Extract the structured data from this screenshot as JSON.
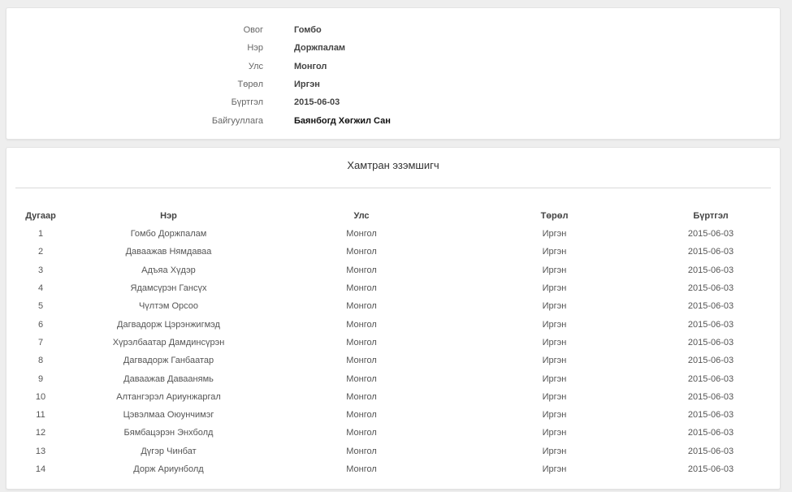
{
  "info": {
    "rows": [
      {
        "label": "Овог",
        "value": "Гомбо"
      },
      {
        "label": "Нэр",
        "value": "Доржпалам"
      },
      {
        "label": "Улс",
        "value": "Монгол"
      },
      {
        "label": "Төрөл",
        "value": "Иргэн"
      },
      {
        "label": "Бүртгэл",
        "value": "2015-06-03"
      },
      {
        "label": "Байгууллага",
        "value": "Баянбогд Хөгжил Сан"
      }
    ]
  },
  "owners": {
    "title": "Хамтран эзэмшигч",
    "columns": [
      "Дугаар",
      "Нэр",
      "Улс",
      "Төрөл",
      "Бүртгэл"
    ],
    "rows": [
      [
        "1",
        "Гомбо Доржпалам",
        "Монгол",
        "Иргэн",
        "2015-06-03"
      ],
      [
        "2",
        "Даваажав Нямдаваа",
        "Монгол",
        "Иргэн",
        "2015-06-03"
      ],
      [
        "3",
        "Адъяа Хүдэр",
        "Монгол",
        "Иргэн",
        "2015-06-03"
      ],
      [
        "4",
        "Ядамсүрэн Гансүх",
        "Монгол",
        "Иргэн",
        "2015-06-03"
      ],
      [
        "5",
        "Чүлтэм Орсоо",
        "Монгол",
        "Иргэн",
        "2015-06-03"
      ],
      [
        "6",
        "Дагвадорж Цэрэнжигмэд",
        "Монгол",
        "Иргэн",
        "2015-06-03"
      ],
      [
        "7",
        "Хүрэлбаатар Дамдинсүрэн",
        "Монгол",
        "Иргэн",
        "2015-06-03"
      ],
      [
        "8",
        "Дагвадорж Ганбаатар",
        "Монгол",
        "Иргэн",
        "2015-06-03"
      ],
      [
        "9",
        "Даваажав Даваанямь",
        "Монгол",
        "Иргэн",
        "2015-06-03"
      ],
      [
        "10",
        "Алтангэрэл Ариунжаргал",
        "Монгол",
        "Иргэн",
        "2015-06-03"
      ],
      [
        "11",
        "Цэвэлмаа Оюунчимэг",
        "Монгол",
        "Иргэн",
        "2015-06-03"
      ],
      [
        "12",
        "Бямбацэрэн Энхболд",
        "Монгол",
        "Иргэн",
        "2015-06-03"
      ],
      [
        "13",
        "Дүгэр Чинбат",
        "Монгол",
        "Иргэн",
        "2015-06-03"
      ],
      [
        "14",
        "Дорж Ариунболд",
        "Монгол",
        "Иргэн",
        "2015-06-03"
      ]
    ]
  }
}
